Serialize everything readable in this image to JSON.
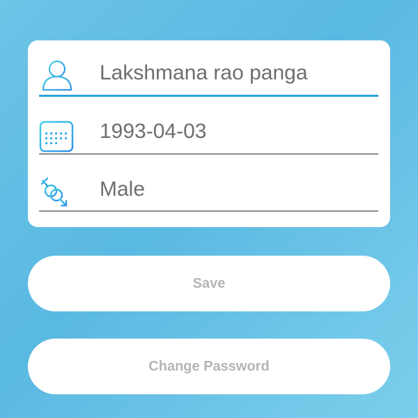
{
  "profile_form": {
    "name": {
      "value": "Lakshmana rao panga",
      "icon": "user-icon"
    },
    "dob": {
      "value": "1993-04-03",
      "icon": "calendar-icon"
    },
    "gender": {
      "value": "Male",
      "icon": "gender-icon"
    }
  },
  "actions": {
    "save_label": "Save",
    "change_password_label": "Change Password"
  },
  "colors": {
    "accent": "#2ba3e0",
    "icon_gradient_start": "#45d0e6",
    "icon_gradient_end": "#2f8fe8",
    "field_text": "#6e6e6e",
    "button_text": "#b5b5b5",
    "background": "#5ab9e2"
  }
}
